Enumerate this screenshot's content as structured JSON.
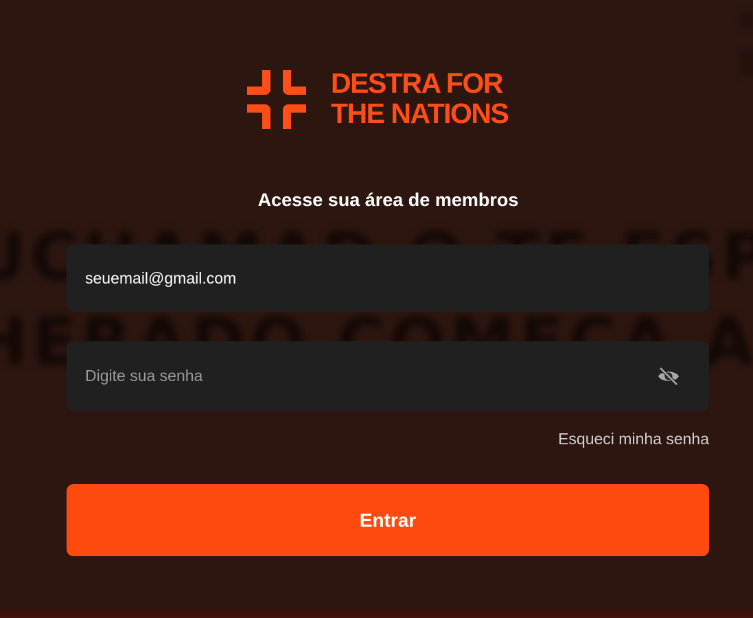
{
  "brand": {
    "logo_icon": "destra-cross-icon",
    "name_line1": "DESTRA FOR",
    "name_line2": "THE NATIONS",
    "color": "#ff4f17"
  },
  "login": {
    "title": "Acesse sua área de membros",
    "email": {
      "value": "seuemail@gmail.com"
    },
    "password": {
      "placeholder": "Digite sua senha",
      "toggle_icon": "eye-off-icon"
    },
    "forgot_label": "Esqueci minha senha",
    "submit_label": "Entrar",
    "accent": "#ff4a0d"
  },
  "background": {
    "color": "#2e1610"
  }
}
